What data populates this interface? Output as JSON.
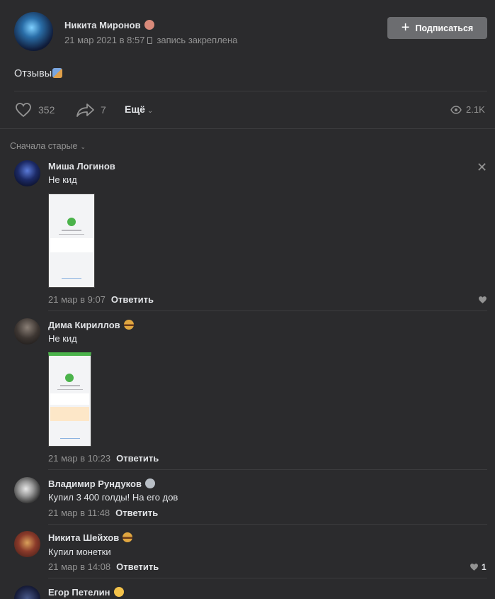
{
  "post": {
    "author": "Никита Миронов",
    "date": "21 мар 2021 в 8:57",
    "pinned_label": "запись закреплена",
    "subscribe_label": "Подписаться",
    "text": "Отзывы",
    "likes": "352",
    "shares": "7",
    "more_label": "Ещё",
    "views": "2.1K"
  },
  "sort_label": "Сначала старые",
  "comments": [
    {
      "name": "Миша Логинов",
      "text": "Не кид",
      "time": "21 мар в 9:07",
      "reply": "Ответить"
    },
    {
      "name": "Дима Кириллов",
      "text": "Не кид",
      "time": "21 мар в 10:23",
      "reply": "Ответить"
    },
    {
      "name": "Владимир Рундуков",
      "text": "Купил 3 400 голды! На его дов",
      "time": "21 мар в 11:48",
      "reply": "Ответить"
    },
    {
      "name": "Никита Шейхов",
      "text": "Купил монетки",
      "time": "21 мар в 14:08",
      "reply": "Ответить",
      "likes": "1"
    },
    {
      "name": "Егор Петелин"
    }
  ],
  "colors": {
    "background": "#2b2b2d",
    "text": "#e1e3e6",
    "muted": "#939393",
    "button": "#6c6d70"
  },
  "icons": [
    "heart-icon",
    "share-icon",
    "eye-icon",
    "plus-icon",
    "close-icon",
    "pin-icon",
    "chevron-down-icon"
  ]
}
